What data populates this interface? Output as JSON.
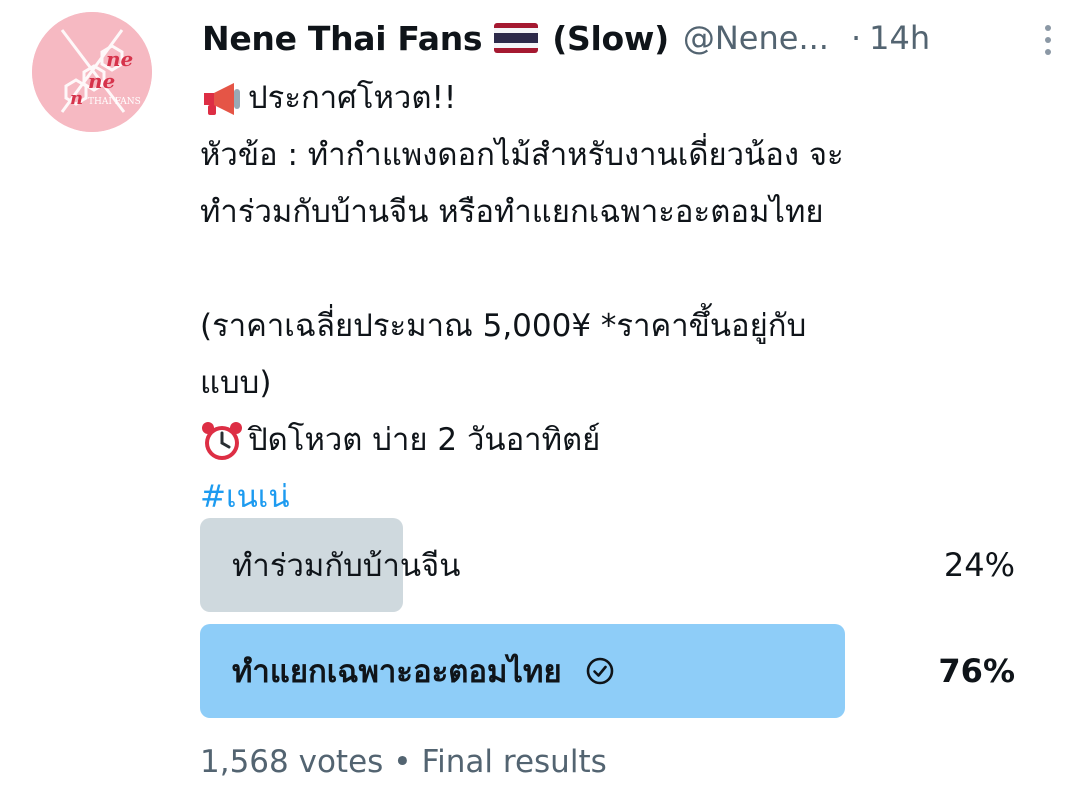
{
  "tweet": {
    "avatar_icon": "nene-thai-fans-logo",
    "avatar_text_1": "ne",
    "avatar_text_2": "ne",
    "avatar_text_3": "n",
    "avatar_text_4": "THAI FANS",
    "author_name": "Nene Thai Fans",
    "flag_icon": "thailand-flag-icon",
    "author_suffix": "(Slow)",
    "handle": "@Nene...",
    "separator": "·",
    "time": "14h",
    "more_icon": "more-vertical-icon",
    "lines": {
      "l1": "ประกาศโหวต!!",
      "l2": "หัวข้อ : ทำกำแพงดอกไม้สำหรับงานเดี่ยวน้อง  จะ",
      "l3": "ทำร่วมกับบ้านจีน  หรือทำแยกเฉพาะอะตอมไทย",
      "l5": "(ราคาเฉลี่ยประมาณ 5,000¥  *ราคาขึ้นอยู่กับ",
      "l6": "แบบ)",
      "l7": "ปิดโหวต บ่าย 2 วันอาทิตย์"
    },
    "megaphone_icon": "megaphone-icon",
    "alarm_icon": "alarm-clock-icon",
    "hashtag": "#เนเน่"
  },
  "poll": {
    "options": [
      {
        "label": "ทำร่วมกับบ้านจีน",
        "percent_text": "24%",
        "fraction": 0.24,
        "winner": false
      },
      {
        "label": "ทำแยกเฉพาะอะตอมไทย",
        "percent_text": "76%",
        "fraction": 0.76,
        "winner": true
      }
    ],
    "winner_icon": "check-circle-icon",
    "votes": "1,568 votes",
    "dot": "•",
    "status": "Final results"
  },
  "colors": {
    "loser_fill": "#cfd9de",
    "winner_fill": "#8ecdf8",
    "accent": "#1d9bf0"
  }
}
